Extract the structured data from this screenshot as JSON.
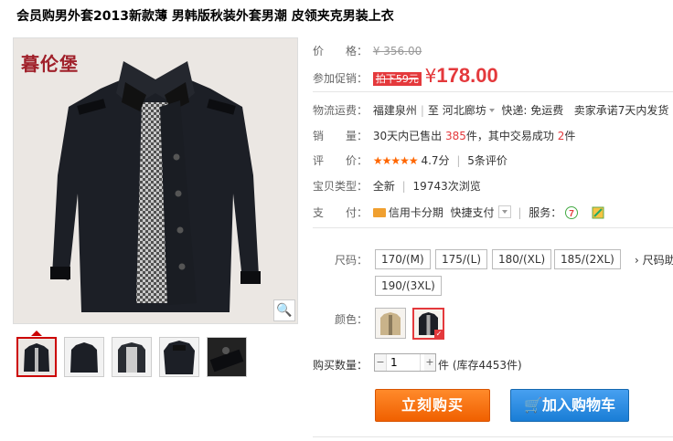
{
  "title": "会员购男外套2013新款薄 男韩版秋装外套男潮 皮领夹克男装上衣",
  "gallery": {
    "brand_logo": "暮伦堡",
    "zoom_icon": "magnifier-icon"
  },
  "price": {
    "label": "价　　格：",
    "original": "¥ 356.00"
  },
  "promo": {
    "label": "参加促销：",
    "tag": "拍下59元",
    "currency": "¥",
    "value": "178.00"
  },
  "shipping": {
    "label": "物流运费：",
    "from": "福建泉州",
    "to_prefix": "至",
    "to": "河北廊坊",
    "fee": "快递: 免运费",
    "promise": "卖家承诺7天内发货"
  },
  "sales": {
    "label": "销　　量：",
    "prefix": "30天内已售出",
    "sold": "385",
    "mid": "件，其中交易成功",
    "success": "2",
    "suffix": "件"
  },
  "rating": {
    "label": "评　　价：",
    "stars": "★★★★★",
    "score": "4.7分",
    "reviews": "5条评价"
  },
  "condition": {
    "label": "宝贝类型：",
    "type": "全新",
    "views": "19743次浏览"
  },
  "payment": {
    "label": "支　　付：",
    "credit": "信用卡分期",
    "quick": "快捷支付",
    "service_label": "服务："
  },
  "sizes": {
    "label": "尺码：",
    "options": [
      "170/(M)",
      "175/(L)",
      "180/(XL)",
      "185/(2XL)",
      "190/(3XL)"
    ],
    "guide": "尺码助"
  },
  "colors": {
    "label": "颜色："
  },
  "quantity": {
    "label": "购买数量：",
    "value": "1",
    "stock": "件 (库存4453件)"
  },
  "actions": {
    "buy": "立刻购买",
    "cart": "加入购物车"
  },
  "theme": {
    "accent_red": "#e4393c",
    "buy_orange": "#f06000",
    "cart_blue": "#1a7ed6"
  }
}
